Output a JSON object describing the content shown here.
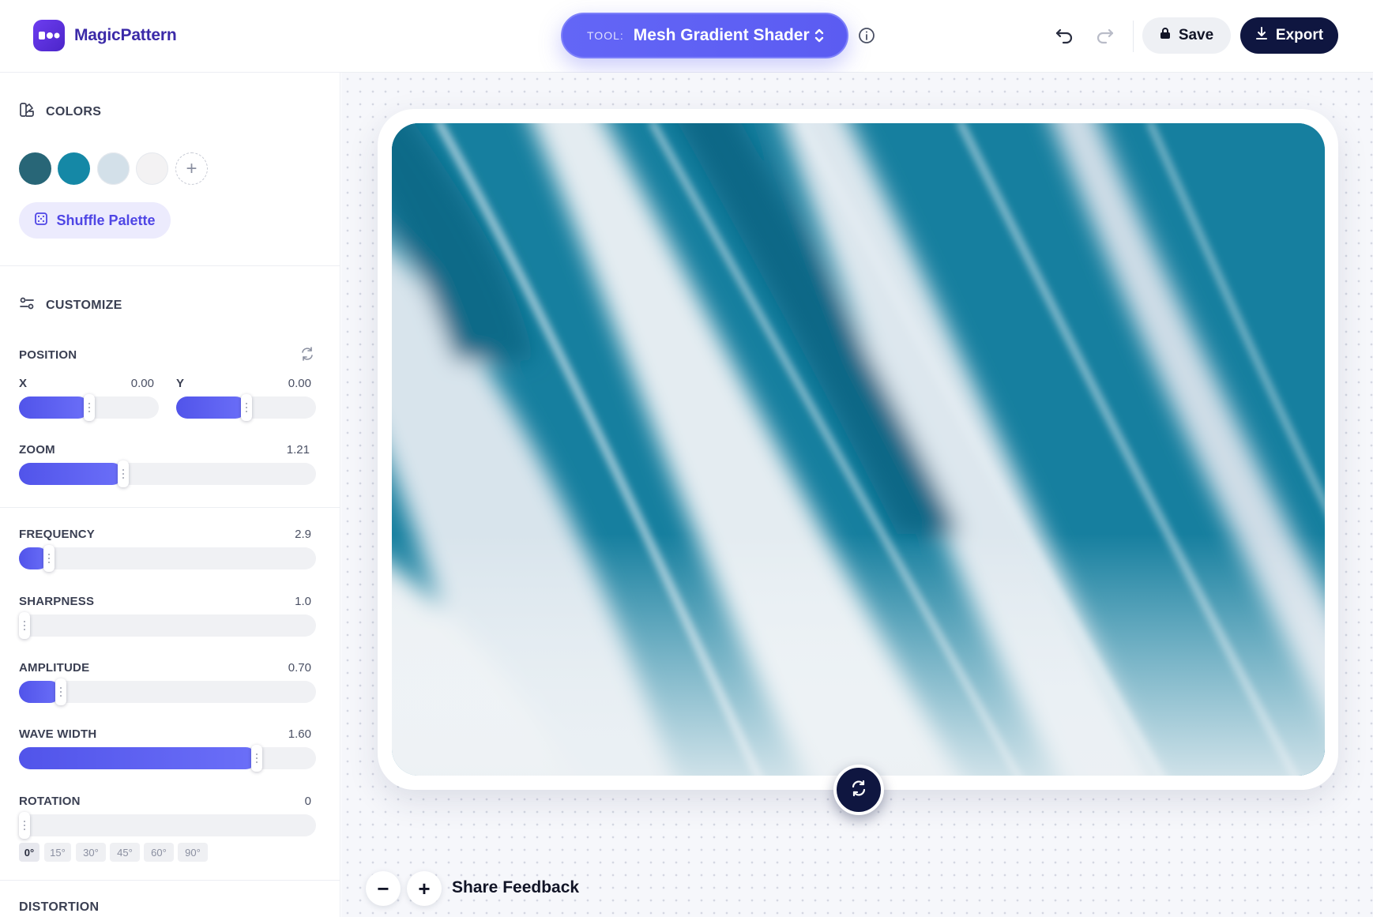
{
  "app": {
    "name": "MagicPattern"
  },
  "toolbar": {
    "tool_label": "TOOL:",
    "tool_value": "Mesh Gradient Shader",
    "save_label": "Save",
    "export_label": "Export"
  },
  "colors": {
    "title": "COLORS",
    "swatches": [
      "#286677",
      "#1588a6",
      "#d3e0e9",
      "#f3f2f3"
    ],
    "shuffle_label": "Shuffle Palette"
  },
  "customize": {
    "title": "CUSTOMIZE",
    "position": {
      "label": "POSITION",
      "x": {
        "label": "X",
        "value": "0.00",
        "fraction": 0.5
      },
      "y": {
        "label": "Y",
        "value": "0.00",
        "fraction": 0.5
      }
    },
    "zoom": {
      "label": "ZOOM",
      "value": "1.21",
      "fraction": 0.35
    },
    "frequency": {
      "label": "FREQUENCY",
      "value": "2.9",
      "fraction": 0.1
    },
    "sharpness": {
      "label": "SHARPNESS",
      "value": "1.0",
      "fraction": 0.0
    },
    "amplitude": {
      "label": "AMPLITUDE",
      "value": "0.70",
      "fraction": 0.14
    },
    "wave_width": {
      "label": "WAVE WIDTH",
      "value": "1.60",
      "fraction": 0.8
    },
    "rotation": {
      "label": "ROTATION",
      "value": "0",
      "fraction": 0.0,
      "presets": [
        "0°",
        "15°",
        "30°",
        "45°",
        "60°",
        "90°"
      ],
      "active_preset": "0°"
    }
  },
  "distortion": {
    "title": "DISTORTION"
  },
  "canvas": {
    "zoom_out": "−",
    "zoom_in": "+",
    "feedback_label": "Share Feedback"
  }
}
